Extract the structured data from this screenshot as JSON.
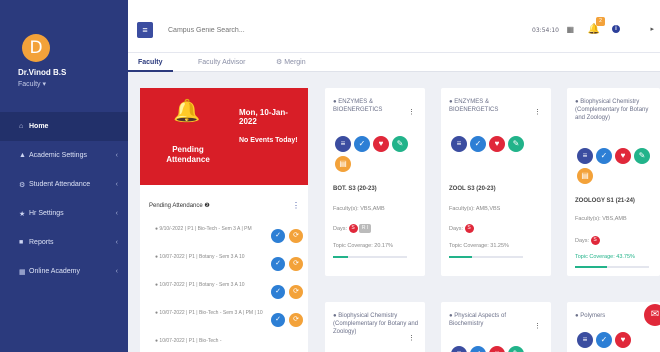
{
  "user": {
    "initial": "D",
    "name": "Dr.Vinod B.S",
    "role": "Faculty ▾"
  },
  "sidebar": {
    "items": [
      {
        "label": "Home",
        "icon": "home-icon",
        "glyph": "⌂"
      },
      {
        "label": "Academic Settings",
        "icon": "graduation-icon",
        "glyph": "▲"
      },
      {
        "label": "Student Attendance",
        "icon": "settings-icon",
        "glyph": "⚙"
      },
      {
        "label": "Hr Settings",
        "icon": "star-icon",
        "glyph": "★"
      },
      {
        "label": "Reports",
        "icon": "folder-icon",
        "glyph": "■"
      },
      {
        "label": "Online Academy",
        "icon": "grid-icon",
        "glyph": "▦"
      }
    ]
  },
  "topbar": {
    "search_placeholder": "Campus Genie Search...",
    "clock": "03:54:10",
    "notification_count": "2"
  },
  "tabs": [
    {
      "label": "Faculty"
    },
    {
      "label": "Faculty Advisor"
    },
    {
      "label": "⚙ Mergin"
    }
  ],
  "pending": {
    "label": "Pending Attendance",
    "date": "Mon, 10-Jan-2022",
    "events": "No Events Today!"
  },
  "pending_list": {
    "header": "Pending Attendance ❷",
    "items": [
      {
        "text": "● 9/10/-2022 | P1 | Bio-Tech - Sem 3 A | PM"
      },
      {
        "text": "● 10/07-2022 | P1 | Botany - Sem 3 A 10"
      },
      {
        "text": "● 10/07-2022 | P1 | Botany - Sem 3 A 10"
      },
      {
        "text": "● 10/07-2022 | P1 | Bio-Tech - Sem 3 A | PM | 10"
      },
      {
        "text": "● 10/07-2022 | P1 | Bio-Tech -"
      }
    ]
  },
  "courses": [
    {
      "title": "● ENZYMES & BIOENERGETICS",
      "code": "BOT. S3 (20-23)",
      "faculty": "Faculty(s): VBS,AMB",
      "days_label": "Days:",
      "days_badge": "S",
      "days_extra": "R I",
      "coverage": "Topic Coverage: 20.17%",
      "coverage_value": 20.17
    },
    {
      "title": "● ENZYMES & BIOENERGETICS",
      "code": "ZOOL S3 (20-23)",
      "faculty": "Faculty(s): AMB,VBS",
      "days_label": "Days:",
      "days_badge": "S",
      "coverage": "Topic Coverage: 31.25%",
      "coverage_value": 31.25
    },
    {
      "title": "● Biophysical Chemistry (Complementary for Botany and Zoology)",
      "code": "ZOOLOGY S1 (21-24)",
      "faculty": "Faculty(s): VBS,AMB",
      "days_label": "Days:",
      "days_badge": "S",
      "coverage": "Topic Coverage: 43.75%",
      "coverage_value": 43.75
    },
    {
      "title": "● Biophysical Chemistry (Complementary for Botany and Zoology)"
    },
    {
      "title": "● Physical Aspects of Biochemistry"
    },
    {
      "title": "● Polymers"
    }
  ]
}
